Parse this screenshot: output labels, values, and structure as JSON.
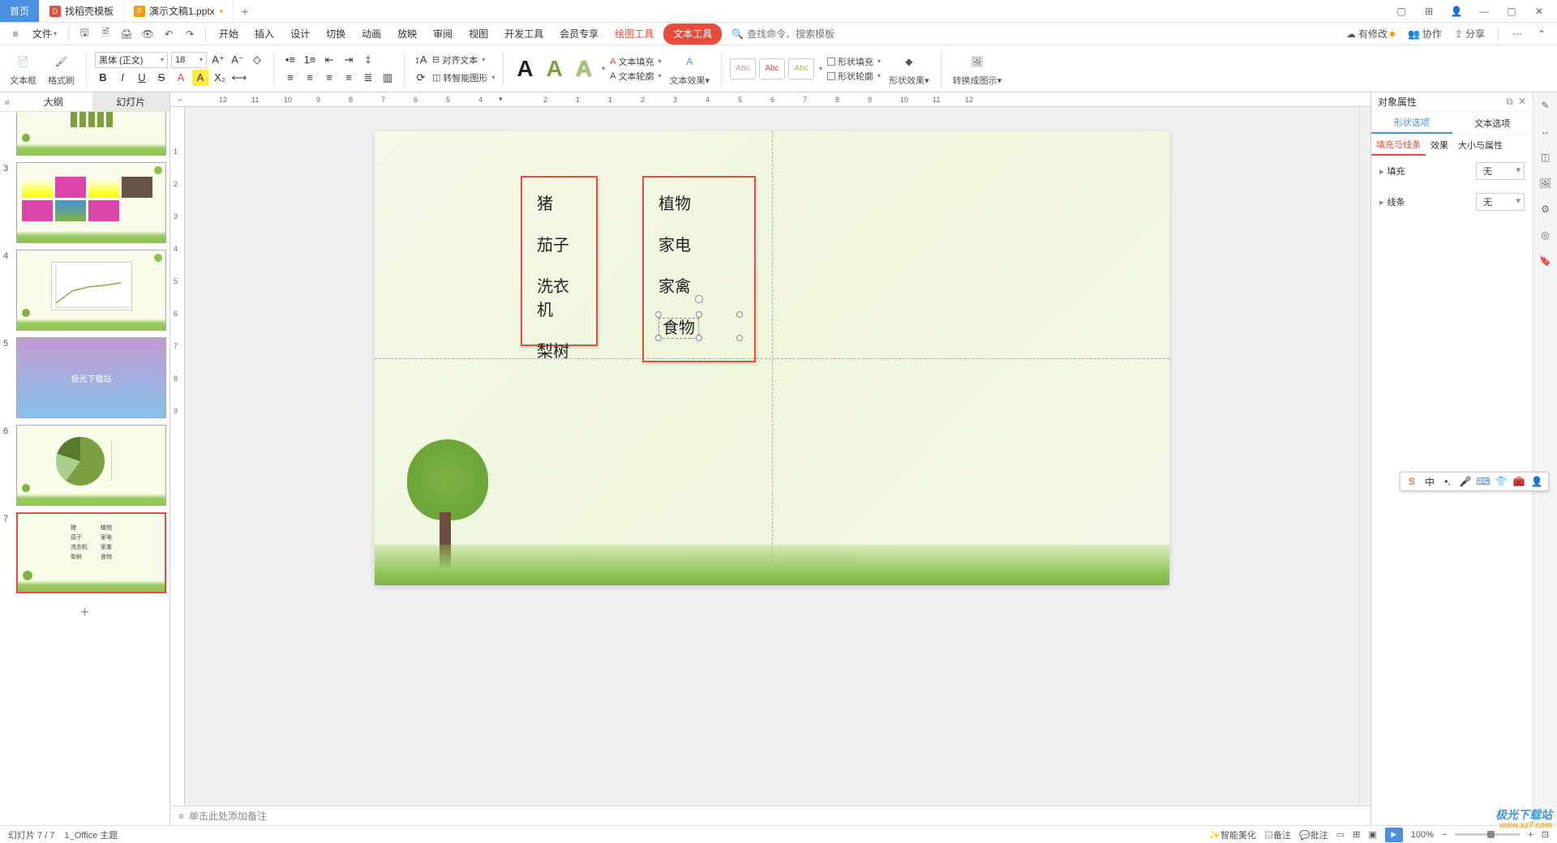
{
  "titlebar": {
    "tabs": [
      {
        "label": "首页"
      },
      {
        "label": "找稻壳模板"
      },
      {
        "label": "演示文稿1.pptx"
      }
    ],
    "add": "+"
  },
  "menubar": {
    "file": "文件",
    "items": [
      "开始",
      "插入",
      "设计",
      "切换",
      "动画",
      "放映",
      "审阅",
      "视图",
      "开发工具",
      "会员专享"
    ],
    "draw_tool": "绘图工具",
    "text_tool": "文本工具",
    "search_placeholder": "查找命令、搜索模板",
    "right": {
      "pending": "有修改",
      "collab": "协作",
      "share": "分享"
    }
  },
  "ribbon": {
    "textbox": "文本框",
    "format_painter": "格式刷",
    "font_name": "黑体 (正文)",
    "font_size": "18",
    "align_text": "对齐文本",
    "smart_shape": "转智能图形",
    "text_fill": "文本填充",
    "text_outline": "文本轮廓",
    "text_effect": "文本效果",
    "shape_fill": "形状填充",
    "shape_outline": "形状轮廓",
    "shape_effect": "形状效果",
    "convert_pic": "转换成图示",
    "abc": "Abc"
  },
  "sidepanel": {
    "tabs": {
      "outline": "大纲",
      "slides": "幻灯片"
    },
    "thumbs": [
      {
        "num": ""
      },
      {
        "num": "3"
      },
      {
        "num": "4"
      },
      {
        "num": "5",
        "label": "极光下载站"
      },
      {
        "num": "6"
      },
      {
        "num": "7"
      }
    ]
  },
  "slide": {
    "box1": [
      "猪",
      "茄子",
      "洗衣机",
      "梨树"
    ],
    "box2": [
      "植物",
      "家电",
      "家禽",
      "食物"
    ]
  },
  "notes": {
    "placeholder": "单击此处添加备注"
  },
  "props": {
    "title": "对象属性",
    "tabs": {
      "shape": "形状选项",
      "text": "文本选项"
    },
    "subtabs": {
      "fill": "填充与线条",
      "effect": "效果",
      "size": "大小与属性"
    },
    "rows": {
      "fill_label": "填充",
      "fill_value": "无",
      "line_label": "线条",
      "line_value": "无"
    }
  },
  "status": {
    "slide_pos": "幻灯片 7 / 7",
    "theme": "1_Office 主题",
    "beautify": "智能美化",
    "notes": "备注",
    "bulk": "批注",
    "zoom": "100%"
  },
  "ime": {
    "cn": "中"
  },
  "watermark": {
    "brand": "极光下载站",
    "url": "www.xz7.com"
  }
}
